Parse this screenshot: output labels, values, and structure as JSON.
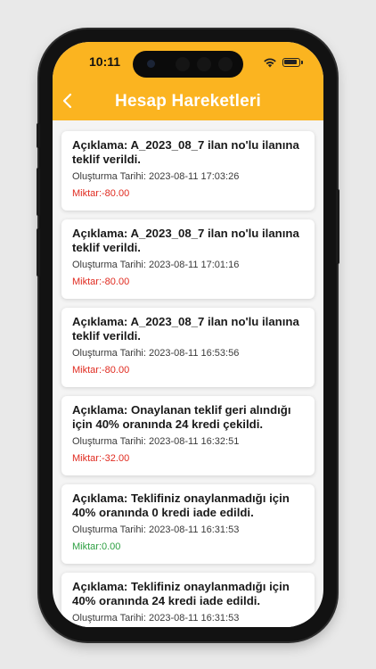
{
  "status_bar": {
    "time": "10:11"
  },
  "header": {
    "title": "Hesap Hareketleri",
    "back_icon": "chevron-left-icon",
    "bg_color": "#fbb420"
  },
  "transactions": [
    {
      "description": "Açıklama: A_2023_08_7 ilan no'lu ilanına teklif verildi.",
      "created": "Oluşturma Tarihi: 2023-08-11 17:03:26",
      "amount": "Miktar:-80.00",
      "type": "negative"
    },
    {
      "description": "Açıklama: A_2023_08_7 ilan no'lu ilanına teklif verildi.",
      "created": "Oluşturma Tarihi: 2023-08-11 17:01:16",
      "amount": "Miktar:-80.00",
      "type": "negative"
    },
    {
      "description": "Açıklama: A_2023_08_7 ilan no'lu ilanına teklif verildi.",
      "created": "Oluşturma Tarihi: 2023-08-11 16:53:56",
      "amount": "Miktar:-80.00",
      "type": "negative"
    },
    {
      "description": "Açıklama: Onaylanan teklif geri alındığı için 40% oranında 24 kredi çekildi.",
      "created": "Oluşturma Tarihi: 2023-08-11 16:32:51",
      "amount": "Miktar:-32.00",
      "type": "negative"
    },
    {
      "description": "Açıklama: Teklifiniz onaylanmadığı için 40% oranında 0 kredi iade edildi.",
      "created": "Oluşturma Tarihi: 2023-08-11 16:31:53",
      "amount": "Miktar:0.00",
      "type": "positive"
    },
    {
      "description": "Açıklama: Teklifiniz onaylanmadığı için 40% oranında 24 kredi iade edildi.",
      "created": "Oluşturma Tarihi: 2023-08-11 16:31:53",
      "amount": "",
      "type": "positive"
    }
  ],
  "colors": {
    "negative": "#e02b20",
    "positive": "#2ea043"
  }
}
